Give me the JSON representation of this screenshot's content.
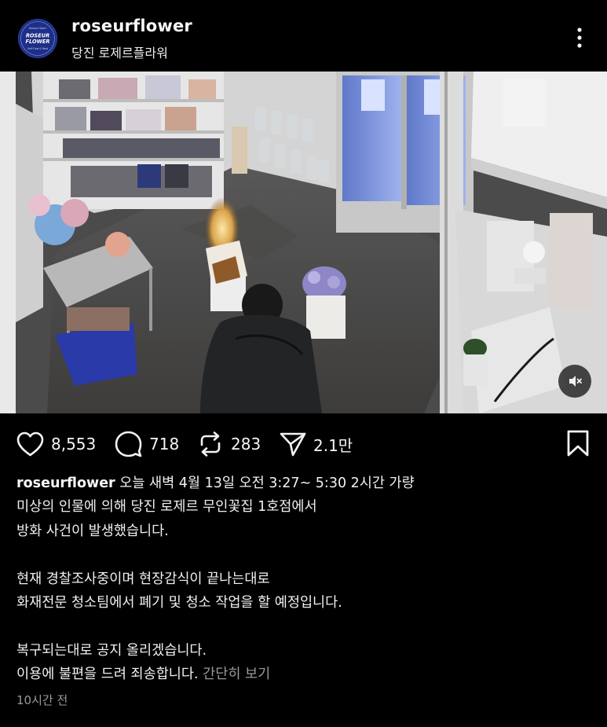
{
  "post": {
    "username": "roseurflower",
    "location": "당진 로제르플라워",
    "avatar": {
      "brand_small": "Always Sport",
      "brand_line1": "ROSEUR",
      "brand_line2": "FLOWER",
      "brand_tagline": "Self-Flow & Rept",
      "color": "#1d2f86"
    },
    "more_icon": "more-vertical-icon",
    "mute_icon": "muted-speaker-icon"
  },
  "actions": {
    "likes": "8,553",
    "comments": "718",
    "reposts": "283",
    "shares": "2.1만",
    "icons": [
      "heart-icon",
      "comment-icon",
      "repost-icon",
      "send-icon",
      "bookmark-icon"
    ]
  },
  "caption": {
    "user": "roseurflower",
    "line1_rest": " 오늘 새벽 4월 13일 오전 3:27~ 5:30 2시간 가량",
    "line2": "미상의 인물에 의해 당진 로제르 무인꽃집 1호점에서",
    "line3": "방화 사건이 발생했습니다.",
    "line4": "현재 경찰조사중이며 현장감식이 끝나는대로",
    "line5": "화재전문 청소팀에서 폐기 및 청소 작업을 할 예정입니다.",
    "line6": "복구되는대로 공지 올리겠습니다.",
    "line7": "이용에 불편을 드려 죄송합니다.",
    "more": " 간단히 보기"
  },
  "timestamp": "10시간 전",
  "colors": {
    "background": "#000000",
    "text": "#f5f5f5",
    "muted": "#9b9b9b",
    "avatar_blue": "#1d2f86"
  }
}
